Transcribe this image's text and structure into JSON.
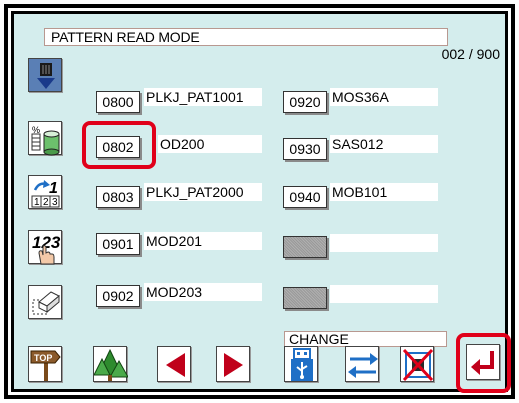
{
  "header": {
    "title": "PATTERN READ MODE",
    "page_count": "002 / 900"
  },
  "patterns": [
    {
      "code": "0800",
      "name": "PLKJ_PAT1001"
    },
    {
      "code": "0802",
      "name": "OD200"
    },
    {
      "code": "0803",
      "name": "PLKJ_PAT2000"
    },
    {
      "code": "0901",
      "name": "MOD201"
    },
    {
      "code": "0902",
      "name": "MOD203"
    },
    {
      "code": "0920",
      "name": "MOS36A"
    },
    {
      "code": "0930",
      "name": "SAS012"
    },
    {
      "code": "0940",
      "name": "MOB101"
    }
  ],
  "footer": {
    "change_label": "CHANGE"
  },
  "side_icons": [
    "pattern-read-icon",
    "data-storage-icon",
    "sequence-123-icon",
    "number-touch-icon",
    "eraser-icon"
  ],
  "bottom_icons": [
    "top-signpost-icon",
    "tree-icon",
    "arrow-left-icon",
    "arrow-right-icon",
    "usb-icon",
    "swap-arrows-icon",
    "cancel-icon",
    "enter-icon"
  ],
  "colors": {
    "background": "#d4eded",
    "highlight": "#e0001a",
    "arrow": "#c0001a",
    "blue": "#1f6fc6"
  }
}
